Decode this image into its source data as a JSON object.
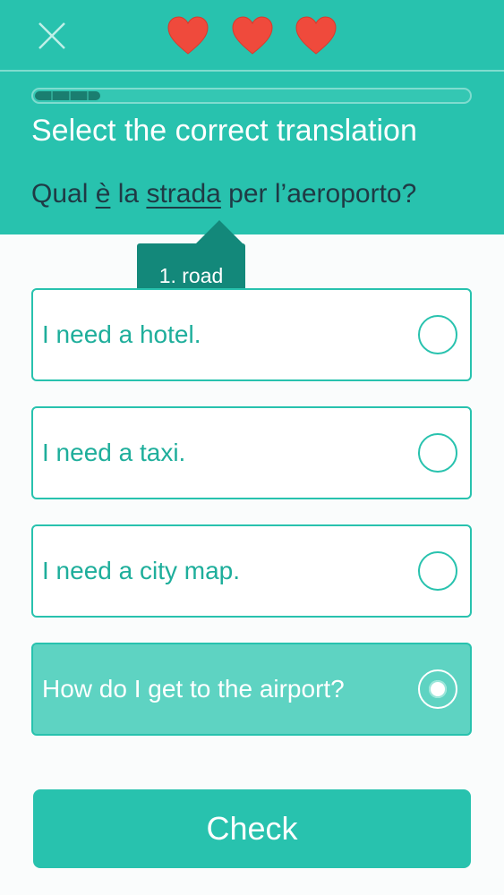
{
  "header": {
    "close_icon": "close-icon",
    "lives": [
      {
        "icon": "heart-icon",
        "color": "#ef4a3c"
      },
      {
        "icon": "heart-icon",
        "color": "#ef4a3c"
      },
      {
        "icon": "heart-icon",
        "color": "#ef4a3c"
      }
    ],
    "progress_fraction": 0.15,
    "instruction": "Select the correct translation",
    "sentence": {
      "parts": [
        "Qual ",
        "è",
        " la ",
        "strada",
        " per l’aeroporto",
        "?"
      ]
    }
  },
  "tooltip": {
    "text": "1. road"
  },
  "options": [
    {
      "label": "I need a hotel.",
      "selected": false
    },
    {
      "label": "I need a taxi.",
      "selected": false
    },
    {
      "label": "I need a city map.",
      "selected": false
    },
    {
      "label": "How do I get to the airport?",
      "selected": true
    }
  ],
  "check_button": {
    "label": "Check"
  },
  "colors": {
    "accent": "#28c2ae",
    "tooltip": "#13887a",
    "heart": "#ef4a3c",
    "selected_option": "#5ed3c2"
  }
}
